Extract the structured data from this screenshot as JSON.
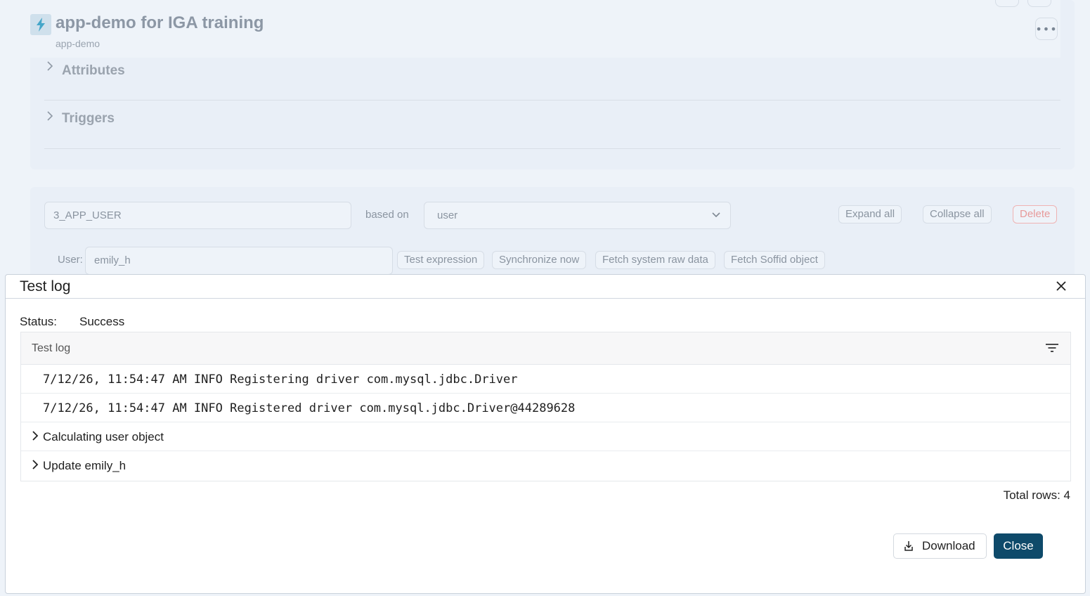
{
  "app": {
    "title": "app-demo for IGA training",
    "subtitle": "app-demo",
    "more_label": "•••"
  },
  "sections": [
    {
      "label": "Attributes"
    },
    {
      "label": "Triggers"
    }
  ],
  "object_panel": {
    "object_name": "3_APP_USER",
    "based_on_label": "based on",
    "based_on_value": "user",
    "expand_all": "Expand all",
    "collapse_all": "Collapse all",
    "delete": "Delete",
    "user_label": "User:",
    "user_value": "emily_h",
    "test_expression": "Test expression",
    "synchronize_now": "Synchronize now",
    "fetch_raw": "Fetch system raw data",
    "fetch_soffid": "Fetch Soffid object"
  },
  "dialog": {
    "title": "Test log",
    "status_label": "Status:",
    "status_value": "Success",
    "table_header": "Test log",
    "rows": [
      {
        "text": "7/12/26, 11:54:47 AM INFO Registering driver com.mysql.jdbc.Driver",
        "expandable": false
      },
      {
        "text": "7/12/26, 11:54:47 AM INFO Registered driver com.mysql.jdbc.Driver@44289628",
        "expandable": false
      },
      {
        "text": "Calculating user object",
        "expandable": true
      },
      {
        "text": "Update emily_h",
        "expandable": true
      }
    ],
    "total_rows": "Total rows: 4",
    "download_label": "Download",
    "close_label": "Close"
  },
  "colors": {
    "primary": "#0e4a6a",
    "danger": "#e79a9a",
    "app_icon": "#45a6c9"
  }
}
